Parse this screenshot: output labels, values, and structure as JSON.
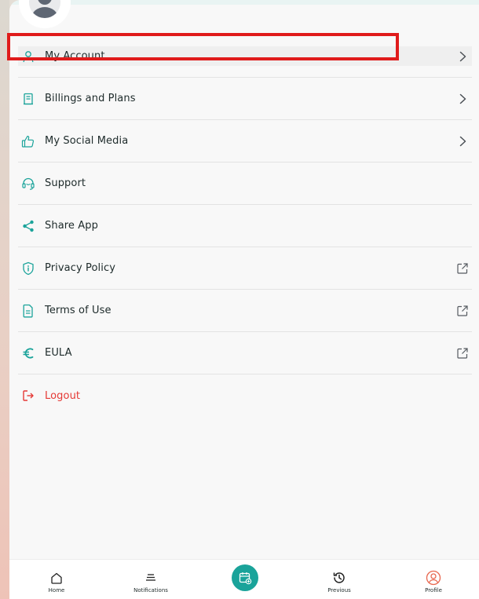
{
  "menu": {
    "items": [
      {
        "label": "My Account",
        "icon": "user-icon",
        "trail": "chevron-right-icon"
      },
      {
        "label": "Billings and Plans",
        "icon": "receipt-icon",
        "trail": "chevron-right-icon"
      },
      {
        "label": "My Social Media",
        "icon": "thumbs-up-icon",
        "trail": "chevron-right-icon"
      },
      {
        "label": "Support",
        "icon": "headset-icon",
        "trail": ""
      },
      {
        "label": "Share App",
        "icon": "share-icon",
        "trail": ""
      },
      {
        "label": "Privacy Policy",
        "icon": "shield-info-icon",
        "trail": "external-link-icon"
      },
      {
        "label": "Terms of Use",
        "icon": "document-icon",
        "trail": "external-link-icon"
      },
      {
        "label": "EULA",
        "icon": "euro-icon",
        "trail": "external-link-icon"
      },
      {
        "label": "Logout",
        "icon": "logout-icon",
        "trail": ""
      }
    ]
  },
  "bottom_nav": {
    "home": "Home",
    "notifications": "Notifications",
    "previous": "Previous",
    "profile": "Profile"
  },
  "colors": {
    "accent": "#1aa39a",
    "logout": "#e53935",
    "highlight": "#e01b1b",
    "profile_active": "#e8674f"
  }
}
